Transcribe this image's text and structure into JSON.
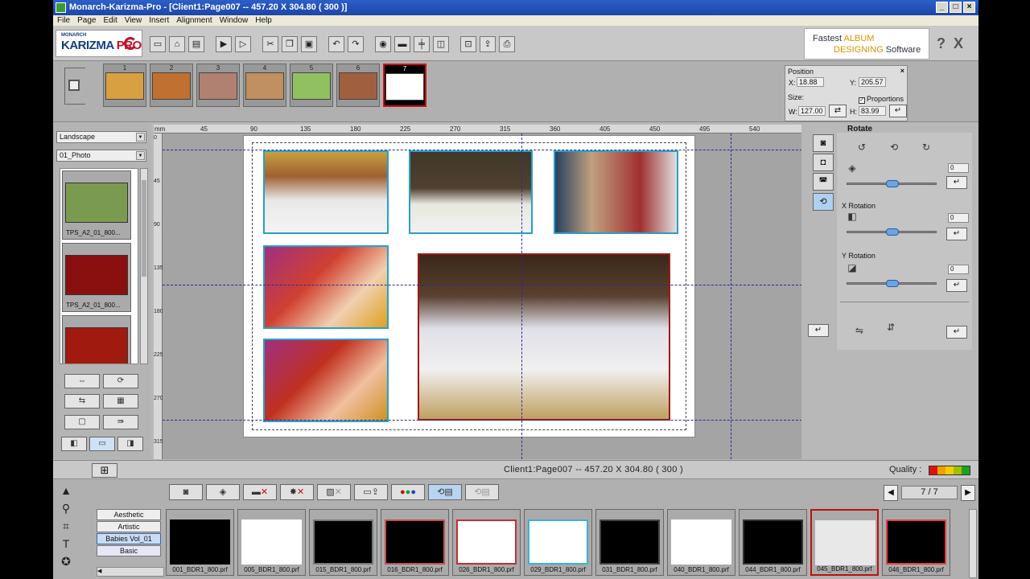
{
  "window": {
    "title": "Monarch-Karizma-Pro - [Client1:Page007 -- 457.20 X 304.80 ( 300 )]",
    "controls": [
      "_",
      "□",
      "×"
    ]
  },
  "menu": [
    "File",
    "Page",
    "Edit",
    "View",
    "Insert",
    "Alignment",
    "Window",
    "Help"
  ],
  "logo": {
    "line1": "MONARCH",
    "line2a": "KARIZMA",
    "line2b": "PRO"
  },
  "banner": {
    "line1a": "Fastest ",
    "line1b": "ALBUM",
    "line2a": "DESIGNING",
    "line2b": " Software"
  },
  "help": {
    "question": "?",
    "close": "X"
  },
  "toolbar_icons": [
    "new-doc-icon",
    "open-folder-icon",
    "save-icon",
    "play-icon",
    "play-all-icon",
    "cut-icon",
    "copy-icon",
    "paste-icon",
    "undo-icon",
    "redo-icon",
    "snapshot-icon",
    "monitor-icon",
    "align-center-icon",
    "split-icon",
    "lock-icon",
    "export-icon",
    "print-icon"
  ],
  "page_thumbs": [
    {
      "num": "1",
      "color": "#d8a040"
    },
    {
      "num": "2",
      "color": "#c07030"
    },
    {
      "num": "3",
      "color": "#b08070"
    },
    {
      "num": "4",
      "color": "#c09060"
    },
    {
      "num": "5",
      "color": "#90c060"
    },
    {
      "num": "6",
      "color": "#a06040"
    },
    {
      "num": "7",
      "color": "#ffffff"
    }
  ],
  "position_panel": {
    "title": "Position",
    "x_label": "X:",
    "x_value": "18.88",
    "y_label": "Y:",
    "y_value": "205.57",
    "size_label": "Size:",
    "proportions_label": "Proportions",
    "proportions_check": "✓",
    "w_label": "W:",
    "w_value": "127.00",
    "h_label": "H:",
    "h_value": "83.99",
    "close": "×"
  },
  "left_panel": {
    "orientation": "Landscape",
    "category": "01_Photo",
    "themes": [
      {
        "label": "TPS_A2_01_800...",
        "color": "#7a9a50"
      },
      {
        "label": "TPS_A2_01_800...",
        "color": "#8a1010"
      },
      {
        "label": "",
        "color": "#a01a10"
      }
    ]
  },
  "ruler": {
    "unit": "mm",
    "h_ticks": [
      "45",
      "90",
      "135",
      "180",
      "225",
      "270",
      "315",
      "360",
      "405",
      "450",
      "495",
      "540"
    ],
    "v_ticks": [
      "0",
      "45",
      "90",
      "135",
      "180",
      "225",
      "270",
      "315"
    ]
  },
  "right_panel": {
    "title": "Rotate",
    "x_rotation": "X Rotation",
    "y_rotation": "Y Rotation",
    "rotate_value": "0",
    "x_value": "0",
    "y_value": "0",
    "rotate_level": 0.5,
    "x_level": 0.5,
    "y_level": 0.5
  },
  "status": {
    "text": "Client1:Page007 -- 457.20 X 304.80 ( 300 )",
    "quality_label": "Quality :",
    "quality_colors": [
      "#e01010",
      "#f0a000",
      "#f0d000",
      "#a0c000",
      "#20a020"
    ]
  },
  "pager": {
    "prev": "◀",
    "value": "7 / 7",
    "next": "▶"
  },
  "categories": [
    "Aesthetic",
    "Artistic",
    "Babies Vol_01",
    "Basic"
  ],
  "borders": [
    {
      "label": "001_BDR1_800.prf",
      "bg": "#000000",
      "frame": "#000000"
    },
    {
      "label": "005_BDR1_800.prf",
      "bg": "#ffffff",
      "frame": "#ffffff"
    },
    {
      "label": "015_BDR1_800.prf",
      "bg": "#000000",
      "frame": "#777777"
    },
    {
      "label": "016_BDR1_800.prf",
      "bg": "#000000",
      "frame": "#c05050"
    },
    {
      "label": "026_BDR1_800.prf",
      "bg": "#ffffff",
      "frame": "#c03030"
    },
    {
      "label": "029_BDR1_800.prf",
      "bg": "#ffffff",
      "frame": "#40b0d0"
    },
    {
      "label": "031_BDR1_800.prf",
      "bg": "#000000",
      "frame": "#444444"
    },
    {
      "label": "040_BDR1_800.prf",
      "bg": "#ffffff",
      "frame": "#ffffff"
    },
    {
      "label": "044_BDR1_800.prf",
      "bg": "#000000",
      "frame": "#333333"
    },
    {
      "label": "045_BDR1_800.prf",
      "bg": "#e8e8e8",
      "frame": "#e8e8e8"
    },
    {
      "label": "046_BDR1_800.prf",
      "bg": "#000000",
      "frame": "#e04040"
    }
  ]
}
